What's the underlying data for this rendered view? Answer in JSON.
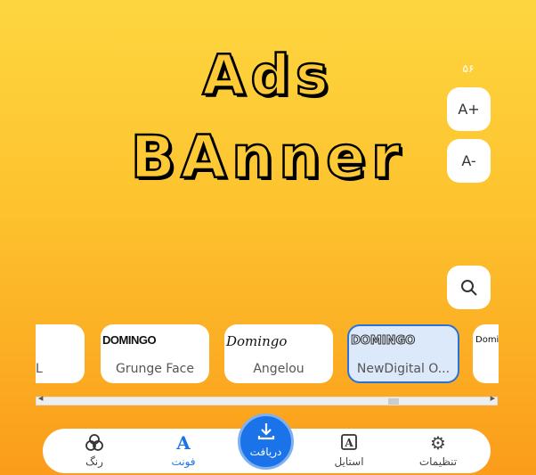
{
  "banner": {
    "line1": "Ads",
    "line2": "BAnner"
  },
  "size": {
    "value": "۵۶",
    "increase": "A+",
    "decrease": "A-"
  },
  "fonts": [
    {
      "preview": "",
      "name": "L"
    },
    {
      "preview": "DOMINGO",
      "name": "Grunge Face"
    },
    {
      "preview": "Domingo",
      "name": "Angelou"
    },
    {
      "preview": "DOMINGO",
      "name": "NewDigital O...",
      "selected": true
    },
    {
      "preview": "Domin",
      "name": ""
    }
  ],
  "nav": {
    "color": "رنگ",
    "font": "فونت",
    "download": "دریافت",
    "style": "استایل",
    "settings": "تنظیمات"
  },
  "colors": {
    "accent": "#1a73e8",
    "bg_top": "#fdd63f",
    "bg_bottom": "#fb9c1a"
  }
}
